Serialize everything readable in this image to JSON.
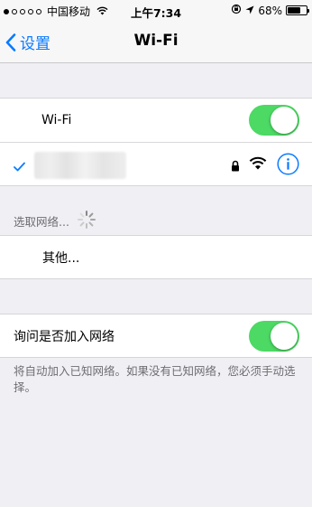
{
  "status_bar": {
    "carrier": "中国移动",
    "time": "上午7:34",
    "battery_percent": "68%",
    "battery_level": 0.68
  },
  "nav": {
    "back_label": "设置",
    "title": "Wi-Fi"
  },
  "wifi_toggle": {
    "label": "Wi-Fi",
    "on": true
  },
  "connected_network": {
    "name_obscured": true,
    "secured": true,
    "icons": [
      "checkmark-icon",
      "lock-icon",
      "wifi-signal-icon",
      "info-icon"
    ]
  },
  "choose_network": {
    "header": "选取网络...",
    "other_label": "其他..."
  },
  "ask_to_join": {
    "label": "询问是否加入网络",
    "on": true,
    "footer": "将自动加入已知网络。如果没有已知网络，您必须手动选择。"
  },
  "colors": {
    "accent": "#0a7aff",
    "toggle_on": "#4cd964",
    "background": "#efeff4"
  }
}
